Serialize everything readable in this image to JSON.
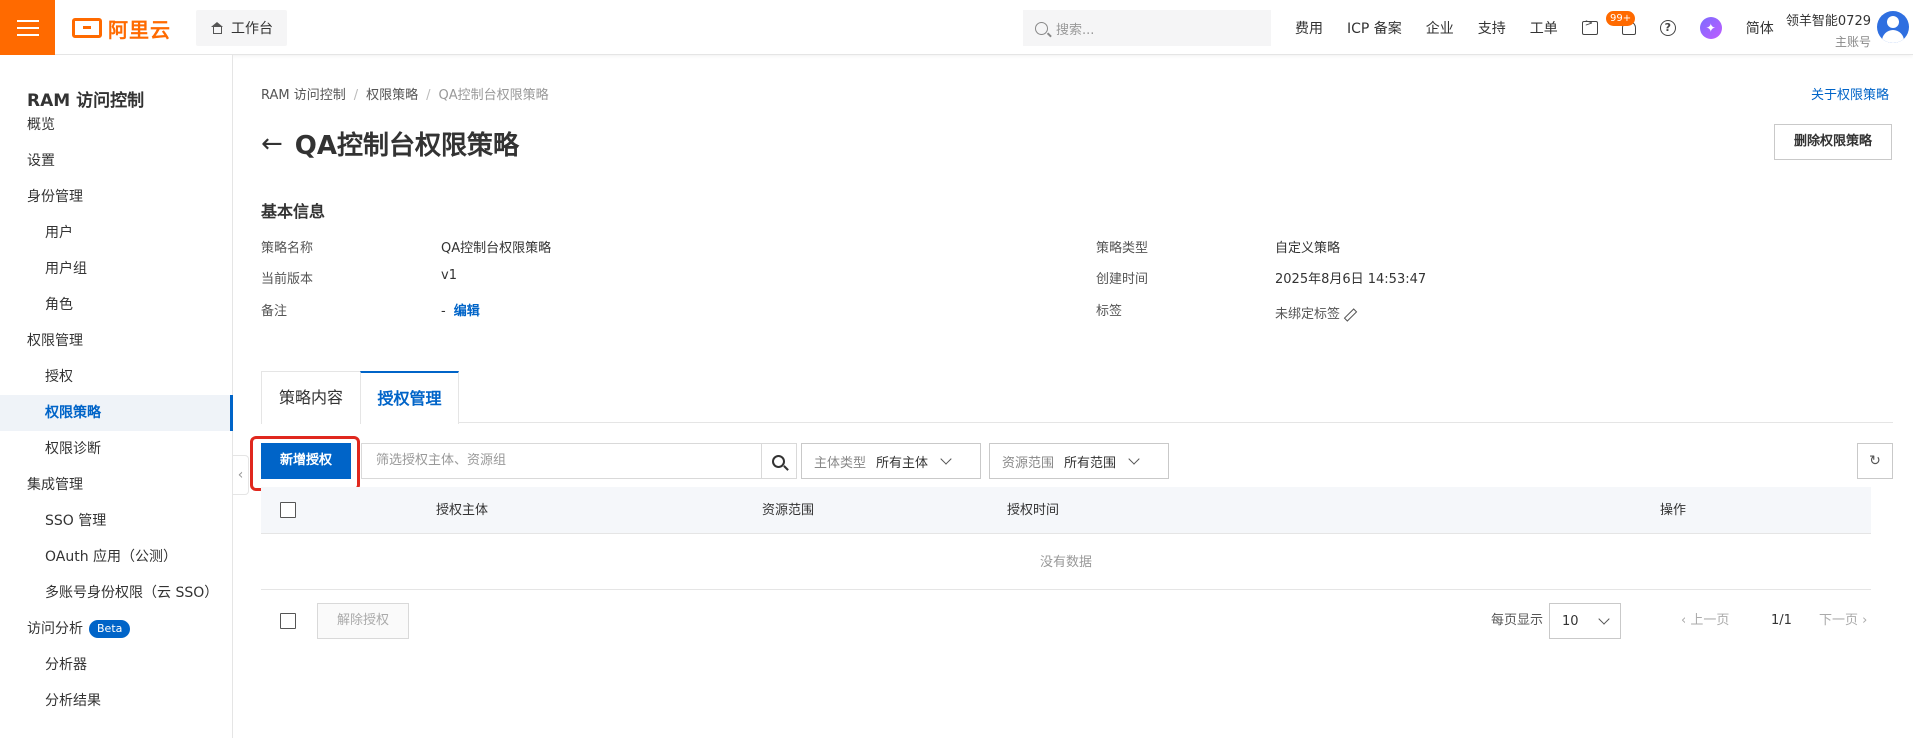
{
  "topbar": {
    "logo_text": "阿里云",
    "workbench": "工作台",
    "search_placeholder": "搜索...",
    "nav": [
      "费用",
      "ICP 备案",
      "企业",
      "支持",
      "工单"
    ],
    "badge": "99+",
    "lang": "简体",
    "account_name": "领羊智能0729",
    "account_sub": "主账号",
    "accent_color": "#ff6a00"
  },
  "sidebar": {
    "title": "RAM 访问控制",
    "items": [
      {
        "label": "概览",
        "level": 1
      },
      {
        "label": "设置",
        "level": 1
      },
      {
        "label": "身份管理",
        "level": 1
      },
      {
        "label": "用户",
        "level": 2
      },
      {
        "label": "用户组",
        "level": 2
      },
      {
        "label": "角色",
        "level": 2
      },
      {
        "label": "权限管理",
        "level": 1
      },
      {
        "label": "授权",
        "level": 2
      },
      {
        "label": "权限策略",
        "level": 2,
        "active": true
      },
      {
        "label": "权限诊断",
        "level": 2
      },
      {
        "label": "集成管理",
        "level": 1
      },
      {
        "label": "SSO 管理",
        "level": 2
      },
      {
        "label": "OAuth 应用（公测）",
        "level": 2
      },
      {
        "label": "多账号身份权限（云 SSO）",
        "level": 2
      },
      {
        "label": "访问分析",
        "level": 1,
        "badge": "Beta"
      },
      {
        "label": "分析器",
        "level": 2
      },
      {
        "label": "分析结果",
        "level": 2
      }
    ]
  },
  "breadcrumb": [
    "RAM 访问控制",
    "权限策略",
    "QA控制台权限策略"
  ],
  "about_link": "关于权限策略",
  "page_title": "QA控制台权限策略",
  "delete_button": "删除权限策略",
  "basic_info": {
    "title": "基本信息",
    "policy_name_label": "策略名称",
    "policy_name": "QA控制台权限策略",
    "version_label": "当前版本",
    "version": "v1",
    "remark_label": "备注",
    "remark": "-",
    "edit_link": "编辑",
    "type_label": "策略类型",
    "type": "自定义策略",
    "created_label": "创建时间",
    "created": "2025年8月6日 14:53:47",
    "tags_label": "标签",
    "tags": "未绑定标签"
  },
  "tabs": [
    "策略内容",
    "授权管理"
  ],
  "toolbar": {
    "add_button": "新增授权",
    "filter_placeholder": "筛选授权主体、资源组",
    "principal_type_label": "主体类型",
    "principal_type_value": "所有主体",
    "scope_label": "资源范围",
    "scope_value": "所有范围"
  },
  "table": {
    "columns": [
      "授权主体",
      "资源范围",
      "授权时间",
      "操作"
    ],
    "empty_text": "没有数据"
  },
  "footer": {
    "revoke_button": "解除授权",
    "page_size_label": "每页显示",
    "page_size": "10",
    "prev": "上一页",
    "page": "1/1",
    "next": "下一页"
  }
}
